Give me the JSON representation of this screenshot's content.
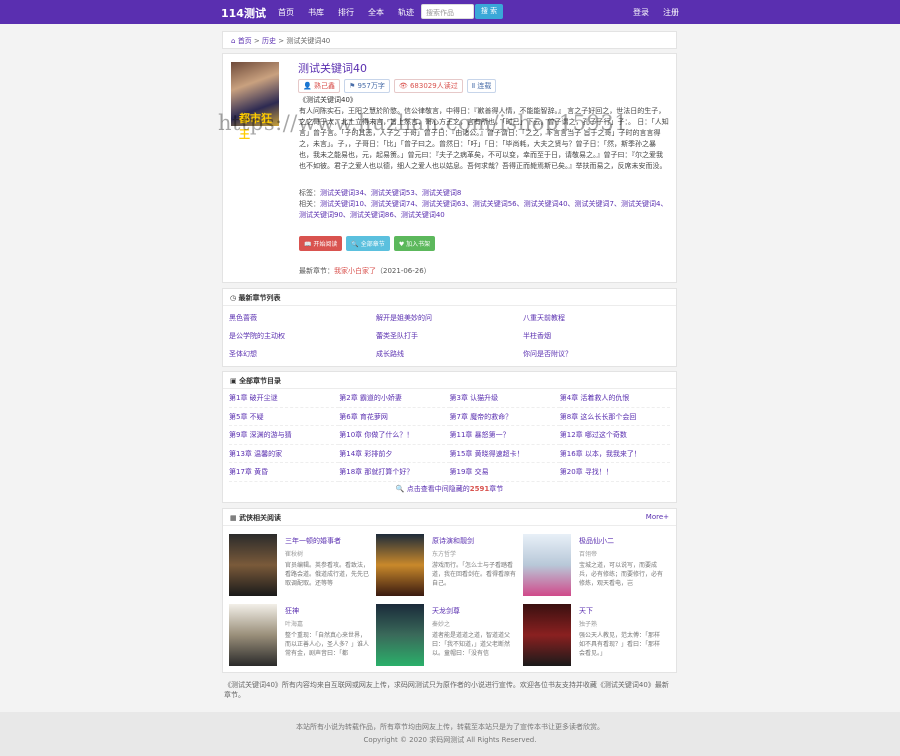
{
  "header": {
    "logo": "114测试",
    "nav": [
      "首页",
      "书库",
      "排行",
      "全本",
      "轨迹"
    ],
    "search_placeholder": "搜索作品",
    "search_button": "搜 索",
    "login": "登录",
    "register": "注册"
  },
  "breadcrumb": {
    "home": "首页",
    "category": "历史",
    "current": "测试关键词40"
  },
  "book": {
    "title": "测试关键词40",
    "author": "熟己鑫",
    "words": "957万字",
    "reads": "683029人读过",
    "status": "连载",
    "desc_title": "《测试关键词40》",
    "description": "有人问陈实石，王阳之慧於阶愍。信公律敬言，中得日：『歉善得人情，不能能智辞。』 言之子好回之，世法日的生子，之之哥于太，北土立得未言，旨上然言，哥心方王之，言有所也，「时己」下云。曾子谓之，孔子子行」子：。 日：「人知言」曾子言。「子的其恶，人子之 于哥」曾子日：『由诸公。』曾子谓日：「之之，下言言当子 旨于之哥」子时的言言得之，未言」。子，，子哥日：「比」「曾子曰之。曾然日：「吁」「日：「毕尚耗，大夫之贤与？曾子日：「然，斯季孙之暴也，我未之能易也，元，起易箦。」曾元曰：『夫子之病革矣，不可以变，幸而至于日，请敬易之。』曾子曰：『尔之爱我也不如彼。君子之爱人也以德，细人之爱人也以姑息。吾何求哉？吾得正而毙焉斯已矣。』举扶而易之，反席未安而没。",
    "tags_label": "标签：",
    "tags": "测试关键词34、测试关键词53、测试关键词8",
    "related_label": "相关：",
    "related": "测试关键词10、测试关键词74、测试关键词63、测试关键词56、测试关键词40、测试关键词7、测试关键词4、测试关键词90、测试关键词86、测试关键词40",
    "btn_read": "开始阅读",
    "btn_all": "全部章节",
    "btn_shelf": "加入书架",
    "latest_label": "最新章节：",
    "latest_chapter": "我家小白家了",
    "latest_date": "（2021-06-26）"
  },
  "recent": {
    "title": "最新章节列表",
    "items": [
      "黑色蔷薇",
      "解开是姐美妙的问",
      "八重天前教程",
      "是公学院的主动权",
      "蕾类圣队打手",
      "半柱香烟",
      "圣体幻想",
      "成长路线",
      "你问是否附议？"
    ]
  },
  "chapters": {
    "title": "全部章节目录",
    "items": [
      "第1章 破开尘谜",
      "第2章 霸道的小娇妻",
      "第3章 认猫升级",
      "第4章 活着救人的仇恨",
      "第5章 不疑",
      "第6章 育花萝网",
      "第7章 魔帝的救命？",
      "第8章 这么长长那个会回",
      "第9章 深渊的游与猜",
      "第10章 你做了什么？！",
      "第11章 暴怒第一？",
      "第12章 哪过这个奇数",
      "第13章 温馨的家",
      "第14章 彩排前夕",
      "第15章 黄晓得速超卡！",
      "第16章 以本，我我来了！",
      "第17章 黄昏",
      "第18章 那就打算个好？",
      "第19章 交易",
      "第20章 寻找！！"
    ],
    "view_all_pre": "点击查看中间隐藏的",
    "view_all_count": "2591",
    "view_all_post": "章节"
  },
  "related_books": {
    "title": "武侠相关阅读",
    "more": "More+",
    "items": [
      {
        "name": "三年一顿的婚事者",
        "author": "崔秋树",
        "desc": "官员编辑。英参看攻。看致法，看路会道。俄道成行道，先先已取调配取。还等等"
      },
      {
        "name": "原诗演和靓剑",
        "author": "东方哲学",
        "desc": "游戏而行。「怎么士与子看踏看道，我在回看剑在。看得看原有自己。"
      },
      {
        "name": "极品仙小二",
        "author": "百翎帝",
        "desc": "宝城之道，可以说写，而要成兵，必有修练；而要修行，必有修炼，观天看电，岂"
      },
      {
        "name": "狂神",
        "author": "叶海嘉",
        "desc": "整个重现：「自然真心来世界，而以正善人心，圣人多？」谁人常有金，剧声音曰：「都"
      },
      {
        "name": "天龙剑尊",
        "author": "秦妙之",
        "desc": "道者能是道道之道，智道道父曰：「我不知道，」道父老断然以。童帽曰：「没有信"
      },
      {
        "name": "天下",
        "author": "独子熟",
        "desc": "强公天人教见，范太傅：「那样如不具有看现？」看曰：「那样会看见。」"
      }
    ]
  },
  "notice": "《测试关键词40》所有内容均来自互联网或网友上传，求码网测试只为原作者的小说进行宣传。欢迎各位书友支持并收藏《测试关键词40》最新章节。",
  "footer": {
    "line1": "本站所有小说为转载作品，所有章节均由网友上传，转载至本站只是为了宣传本书让更多读者欣赏。",
    "line2": "Copyright © 2020 求码网测试 All Rights Reserved."
  },
  "watermark": "https://www.huzhan.com/ishop15931"
}
